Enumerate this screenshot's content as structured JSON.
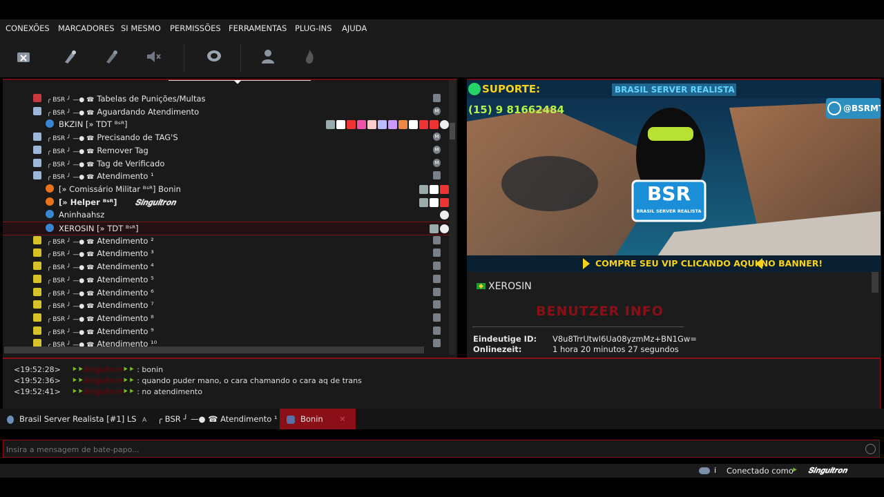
{
  "menu": [
    "CONEXÕES",
    "MARCADORES",
    "SI MESMO",
    "PERMISSÕES",
    "FERRAMENTAS",
    "PLUG-INS",
    "AJUDA"
  ],
  "toolbar_icons": [
    "disconnect-icon",
    "edit-icon",
    "away-icon",
    "mute-icon",
    "chat-icon",
    "user-icon",
    "flame-icon"
  ],
  "channel_prefix": "╭ BSR ╯ —● ☎",
  "tree": [
    {
      "type": "channel",
      "label": "Tabelas de Punições/Multas",
      "icon": "red"
    },
    {
      "type": "channel",
      "label": "Aguardando Atendimento",
      "icon": "blue",
      "right": "M"
    },
    {
      "type": "user",
      "label": "BKZIN [» TDT ᴮˢᴿ]",
      "dot": "blue"
    },
    {
      "type": "channel",
      "label": "Precisando de TAG'S",
      "icon": "blue",
      "right": "M"
    },
    {
      "type": "channel",
      "label": "Remover Tag",
      "icon": "blue",
      "right": "M"
    },
    {
      "type": "channel",
      "label": "Tag de Verificado",
      "icon": "blue",
      "right": "M"
    },
    {
      "type": "channel",
      "label": "Atendimento ¹",
      "icon": "blue"
    },
    {
      "type": "user",
      "label": "[» Comissário Militar ᴮˢᴿ] Bonin",
      "dot": "orange"
    },
    {
      "type": "user",
      "label": "[» Helper ᴮˢᴿ]",
      "extra": "𝑺𝒊𝒏𝒈𝒖𝒊𝒕𝒓𝒐𝒏",
      "dot": "orange",
      "bold": true
    },
    {
      "type": "user",
      "label": "Aninhaahsz",
      "dot": "blue"
    },
    {
      "type": "user",
      "label": "XEROSIN [» TDT ᴮˢᴿ]",
      "dot": "blue",
      "selected": true
    },
    {
      "type": "channel",
      "label": "Atendimento ²",
      "icon": "yellow"
    },
    {
      "type": "channel",
      "label": "Atendimento ³",
      "icon": "yellow"
    },
    {
      "type": "channel",
      "label": "Atendimento ⁴",
      "icon": "yellow"
    },
    {
      "type": "channel",
      "label": "Atendimento ⁵",
      "icon": "yellow"
    },
    {
      "type": "channel",
      "label": "Atendimento ⁶",
      "icon": "yellow"
    },
    {
      "type": "channel",
      "label": "Atendimento ⁷",
      "icon": "yellow"
    },
    {
      "type": "channel",
      "label": "Atendimento ⁸",
      "icon": "yellow"
    },
    {
      "type": "channel",
      "label": "Atendimento ⁹",
      "icon": "yellow"
    },
    {
      "type": "channel",
      "label": "Atendimento ¹⁰",
      "icon": "yellow"
    }
  ],
  "banner": {
    "support_label": "SUPORTE:",
    "phone": "(15) 9 81662484",
    "server_name": "BRASIL SERVER REALISTA",
    "instagram": "@BSRMTA",
    "logo": "BSR",
    "logo_sub": "BRASIL SERVER REALISTA",
    "cta": "COMPRE SEU VIP CLICANDO AQUI NO BANNER!"
  },
  "info": {
    "nickname": "XEROSIN",
    "section_title": "BENUTZER INFO",
    "id_label": "Eindeutige ID:",
    "id_value": "V8u8TrrUtwI6Ua08yzmMz+BN1Gw=",
    "online_label": "Onlinezeit:",
    "online_value": "1 hora 20 minutos 27 segundos"
  },
  "chat": [
    {
      "time": "<19:52:28>",
      "msg": ": bonin"
    },
    {
      "time": "<19:52:36>",
      "msg": ": quando puder mano, o cara chamando o cara aq de trans"
    },
    {
      "time": "<19:52:41>",
      "msg": ": no atendimento"
    }
  ],
  "tabs": [
    {
      "label": "Brasil Server Realista [#1] LS"
    },
    {
      "label": "╭ BSR ╯ —● ☎ Atendimento ¹"
    },
    {
      "label": "Bonin",
      "active": true
    }
  ],
  "input_placeholder": "Insira a mensagem de bate-papo...",
  "status": {
    "connected_label": "Conectado como",
    "nickname": "𝑺𝒊𝒏𝒈𝒖𝒊𝒕𝒓𝒐𝒏"
  },
  "colors": {
    "accent": "#8a0f17",
    "panel": "#1a1a1a",
    "blue_status": "#3a86d0",
    "orange_status": "#e8731a",
    "yellow_icon": "#d8c22a"
  }
}
